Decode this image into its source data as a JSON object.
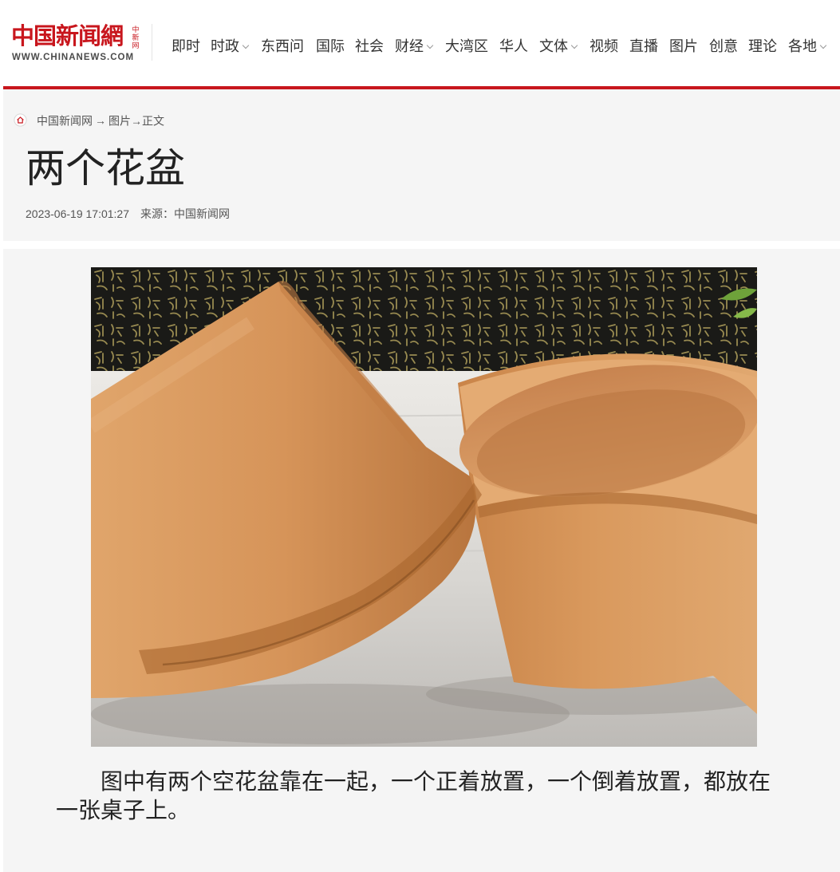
{
  "header": {
    "logo_cn": "中国新闻網",
    "logo_side": "中新网",
    "logo_en": "WWW.CHINANEWS.COM",
    "nav": [
      {
        "label": "即时",
        "dropdown": false
      },
      {
        "label": "时政",
        "dropdown": true
      },
      {
        "label": "东西问",
        "dropdown": false
      },
      {
        "label": "国际",
        "dropdown": false
      },
      {
        "label": "社会",
        "dropdown": false
      },
      {
        "label": "财经",
        "dropdown": true
      },
      {
        "label": "大湾区",
        "dropdown": false
      },
      {
        "label": "华人",
        "dropdown": false
      },
      {
        "label": "文体",
        "dropdown": true
      },
      {
        "label": "视频",
        "dropdown": false
      },
      {
        "label": "直播",
        "dropdown": false
      },
      {
        "label": "图片",
        "dropdown": false
      },
      {
        "label": "创意",
        "dropdown": false
      },
      {
        "label": "理论",
        "dropdown": false
      },
      {
        "label": "各地",
        "dropdown": true
      }
    ]
  },
  "breadcrumb": {
    "home_icon": "home-icon",
    "items": [
      "中国新闻网",
      "图片",
      "正文"
    ],
    "separator": "→"
  },
  "article": {
    "title": "两个花盆",
    "datetime": "2023-06-19 17:01:27",
    "source_label": "来源：中国新闻网",
    "caption": "图中有两个空花盆靠在一起，一个正着放置，一个倒着放置，都放在一张桌子上。"
  },
  "colors": {
    "brand_red": "#c8161d",
    "panel_bg": "#f5f5f5",
    "terracotta": "#d0915a"
  }
}
